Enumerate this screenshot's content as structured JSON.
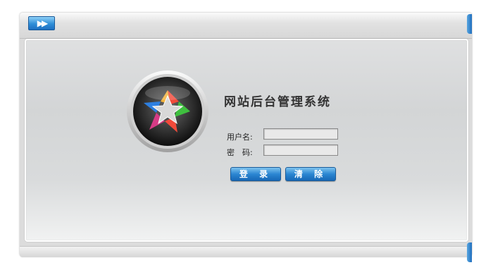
{
  "window": {
    "title": "网站后台管理系统",
    "nav_icon": "fast-forward-icon"
  },
  "login": {
    "username_label": "用户名:",
    "password_label": "密　码:",
    "username_value": "",
    "password_value": "",
    "login_button": "登 录",
    "clear_button": "清 除"
  },
  "logo": {
    "icon": "star-logo-icon",
    "colors": [
      "#f14a3a",
      "#3fbf3f",
      "#2d7fe0",
      "#f3b23a"
    ]
  },
  "colors": {
    "accent": "#2b86d2",
    "panel_bg": "#d9dbdc"
  }
}
